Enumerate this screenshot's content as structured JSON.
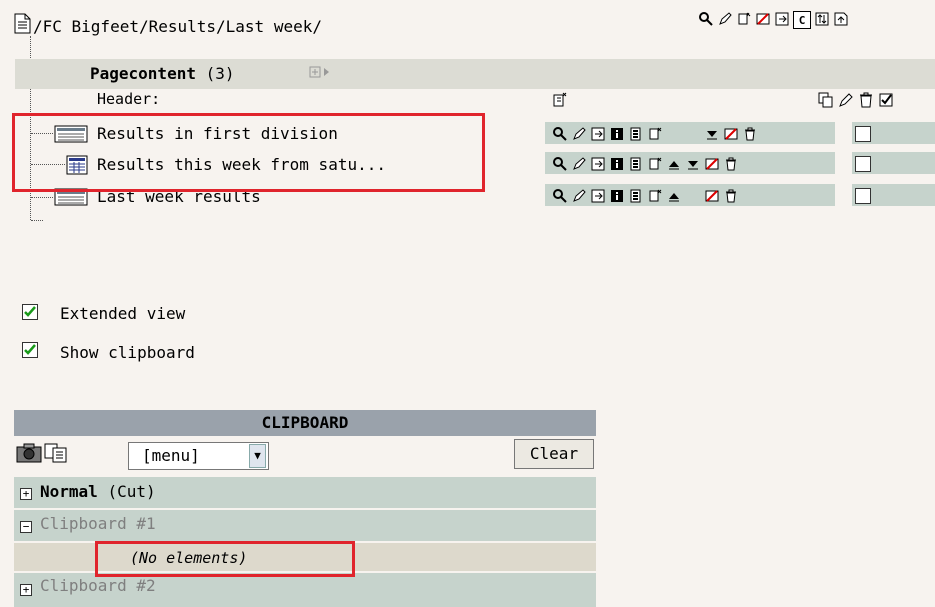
{
  "path": {
    "text": "/FC Bigfeet/Results/Last week/"
  },
  "top_toolbar": {
    "icons": [
      "magnifier-icon",
      "pencil-icon",
      "new-record-icon",
      "no-edit-icon",
      "move-icon",
      "clear-cache-icon",
      "refresh-icon",
      "up-level-icon"
    ],
    "clear_cache_label": "C"
  },
  "pagecontent": {
    "title": "Pagecontent",
    "count": "(3)",
    "header_label": "Header:"
  },
  "rows": [
    {
      "label": "Results in first division"
    },
    {
      "label": "Results this week from satu..."
    },
    {
      "label": "Last week results"
    }
  ],
  "options": {
    "extended_view": {
      "label": "Extended view",
      "checked": true
    },
    "show_clipboard": {
      "label": "Show clipboard",
      "checked": true
    }
  },
  "clipboard": {
    "title": "CLIPBOARD",
    "menu_value": "[menu]",
    "clear_label": "Clear",
    "pads": [
      {
        "name": "Normal",
        "suffix": "(Cut)",
        "expanded": false
      },
      {
        "name": "Clipboard #1",
        "expanded": true,
        "empty_text": "(No elements)"
      },
      {
        "name": "Clipboard #2",
        "expanded": false
      }
    ]
  },
  "colors": {
    "highlight": "#e0242c",
    "row_bg": "#c6d3cc",
    "clip_header": "#9aa2ab"
  }
}
